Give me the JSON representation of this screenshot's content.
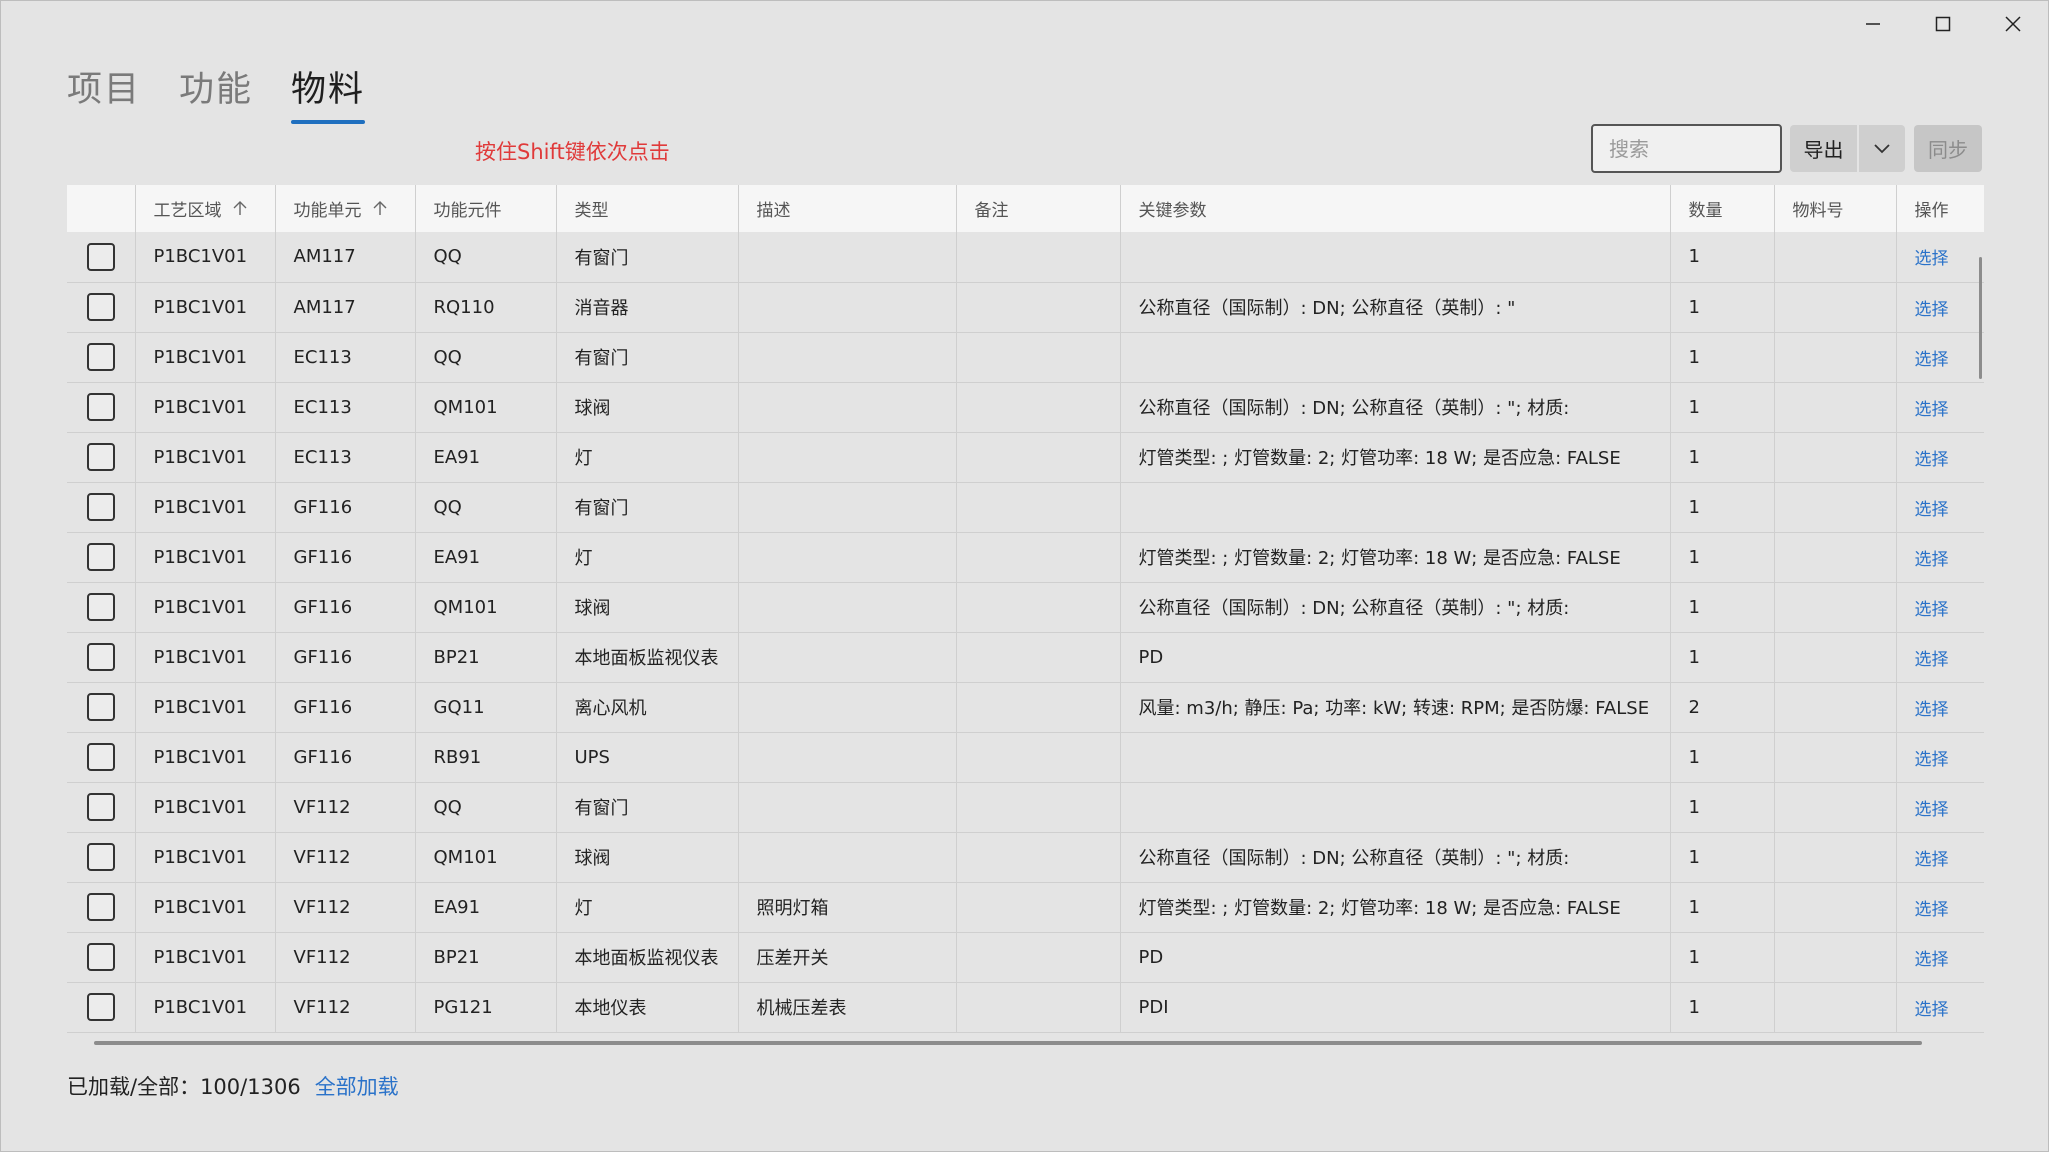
{
  "tabs": [
    {
      "label": "项目",
      "active": false
    },
    {
      "label": "功能",
      "active": false
    },
    {
      "label": "物料",
      "active": true
    }
  ],
  "hint": "按住Shift键依次点击",
  "toolbar": {
    "search_placeholder": "搜索",
    "export_label": "导出",
    "sync_label": "同步"
  },
  "columns": [
    "",
    "工艺区域",
    "功能单元",
    "功能元件",
    "类型",
    "描述",
    "备注",
    "关键参数",
    "数量",
    "物料号",
    "操作"
  ],
  "action_label": "选择",
  "rows": [
    [
      "P1BC1V01",
      "AM117",
      "QQ",
      "有窗门",
      "",
      "",
      "",
      "1",
      ""
    ],
    [
      "P1BC1V01",
      "AM117",
      "RQ110",
      "消音器",
      "",
      "",
      "公称直径（国际制）: DN; 公称直径（英制）: \"",
      "1",
      ""
    ],
    [
      "P1BC1V01",
      "EC113",
      "QQ",
      "有窗门",
      "",
      "",
      "",
      "1",
      ""
    ],
    [
      "P1BC1V01",
      "EC113",
      "QM101",
      "球阀",
      "",
      "",
      "公称直径（国际制）: DN; 公称直径（英制）: \"; 材质:",
      "1",
      ""
    ],
    [
      "P1BC1V01",
      "EC113",
      "EA91",
      "灯",
      "",
      "",
      "灯管类型: ; 灯管数量: 2; 灯管功率: 18 W; 是否应急: FALSE",
      "1",
      ""
    ],
    [
      "P1BC1V01",
      "GF116",
      "QQ",
      "有窗门",
      "",
      "",
      "",
      "1",
      ""
    ],
    [
      "P1BC1V01",
      "GF116",
      "EA91",
      "灯",
      "",
      "",
      "灯管类型: ; 灯管数量: 2; 灯管功率: 18 W; 是否应急: FALSE",
      "1",
      ""
    ],
    [
      "P1BC1V01",
      "GF116",
      "QM101",
      "球阀",
      "",
      "",
      "公称直径（国际制）: DN; 公称直径（英制）: \"; 材质:",
      "1",
      ""
    ],
    [
      "P1BC1V01",
      "GF116",
      "BP21",
      "本地面板监视仪表",
      "",
      "",
      "PD",
      "1",
      ""
    ],
    [
      "P1BC1V01",
      "GF116",
      "GQ11",
      "离心风机",
      "",
      "",
      "风量: m3/h; 静压: Pa; 功率: kW; 转速: RPM; 是否防爆: FALSE",
      "2",
      ""
    ],
    [
      "P1BC1V01",
      "GF116",
      "RB91",
      "UPS",
      "",
      "",
      "",
      "1",
      ""
    ],
    [
      "P1BC1V01",
      "VF112",
      "QQ",
      "有窗门",
      "",
      "",
      "",
      "1",
      ""
    ],
    [
      "P1BC1V01",
      "VF112",
      "QM101",
      "球阀",
      "",
      "",
      "公称直径（国际制）: DN; 公称直径（英制）: \"; 材质:",
      "1",
      ""
    ],
    [
      "P1BC1V01",
      "VF112",
      "EA91",
      "灯",
      "照明灯箱",
      "",
      "灯管类型: ; 灯管数量: 2; 灯管功率: 18 W; 是否应急: FALSE",
      "1",
      ""
    ],
    [
      "P1BC1V01",
      "VF112",
      "BP21",
      "本地面板监视仪表",
      "压差开关",
      "",
      "PD",
      "1",
      ""
    ],
    [
      "P1BC1V01",
      "VF112",
      "PG121",
      "本地仪表",
      "机械压差表",
      "",
      "PDI",
      "1",
      ""
    ]
  ],
  "footer": {
    "loaded_label": "已加载/全部：100/1306",
    "load_all_label": "全部加载"
  }
}
